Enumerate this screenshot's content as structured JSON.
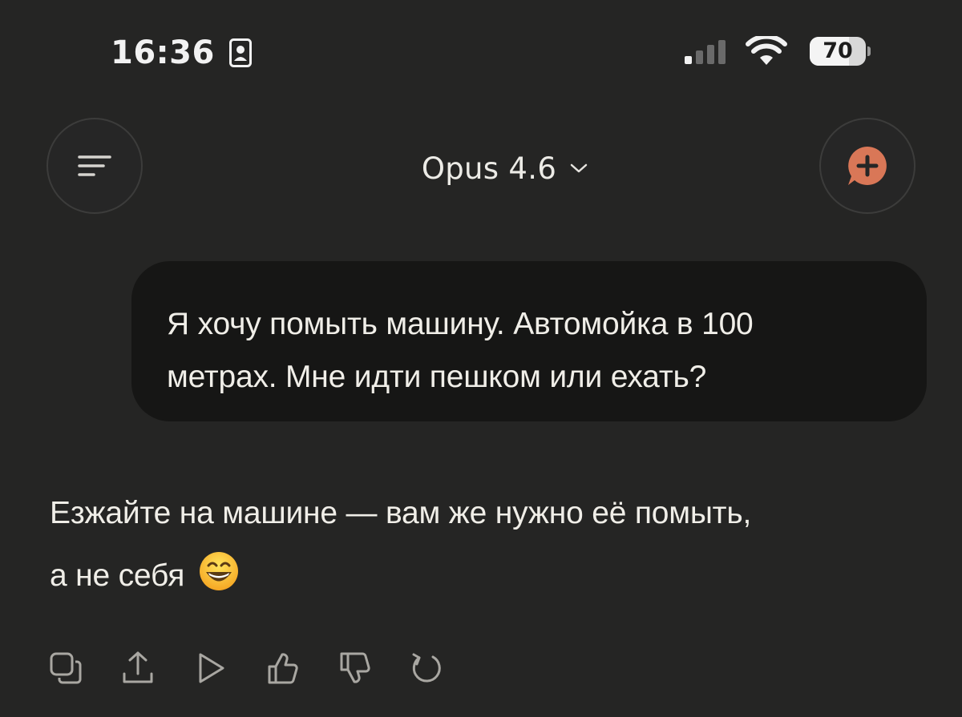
{
  "status_bar": {
    "time": "16:36",
    "battery_level": "70",
    "battery_fraction": 0.7,
    "icons": [
      "contact-card-icon",
      "cellular-signal-icon",
      "wifi-icon",
      "battery-icon"
    ]
  },
  "header": {
    "menu_icon": "hamburger-menu-icon",
    "model_name": "Opus 4.6",
    "model_chevron_icon": "chevron-down-icon",
    "new_chat_icon": "new-chat-plus-bubble-icon"
  },
  "conversation": {
    "user_message": {
      "line1": "Я хочу помыть машину. Автомойка в 100",
      "line2": "метрах. Мне идти пешком или ехать?"
    },
    "assistant_message": {
      "line1": "Езжайте на машине — вам же нужно её помыть,",
      "line2": "а не себя",
      "emoji_icon": "grinning-smiling-eyes-emoji-icon"
    },
    "actions": [
      {
        "name": "copy-icon"
      },
      {
        "name": "share-icon"
      },
      {
        "name": "play-icon"
      },
      {
        "name": "thumbs-up-icon"
      },
      {
        "name": "thumbs-down-icon"
      },
      {
        "name": "retry-icon"
      }
    ]
  },
  "colors": {
    "background": "#252524",
    "user_bubble": "#161615",
    "accent": "#d97757",
    "text": "#f0eee8"
  }
}
